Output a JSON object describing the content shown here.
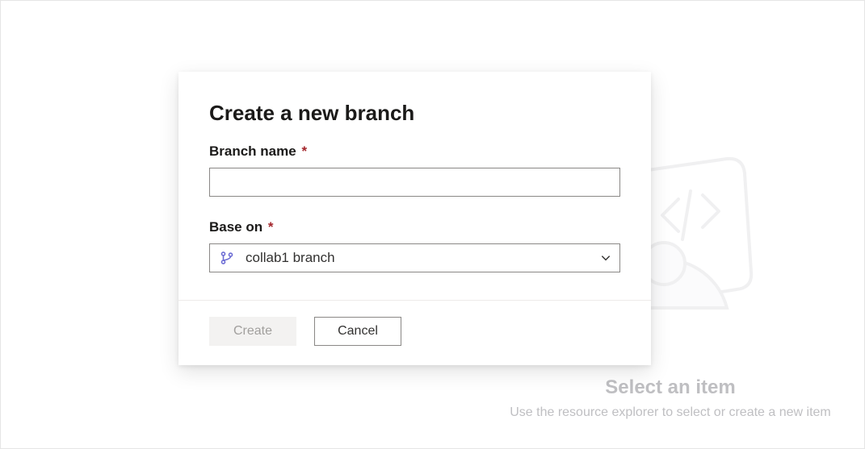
{
  "background": {
    "heading": "Select an item",
    "sub": "Use the resource explorer to select or create a new item"
  },
  "dialog": {
    "title": "Create a new branch",
    "branch_name": {
      "label": "Branch name",
      "required_mark": "*",
      "value": ""
    },
    "base_on": {
      "label": "Base on",
      "required_mark": "*",
      "selected": "collab1 branch"
    },
    "buttons": {
      "create": "Create",
      "cancel": "Cancel"
    }
  }
}
